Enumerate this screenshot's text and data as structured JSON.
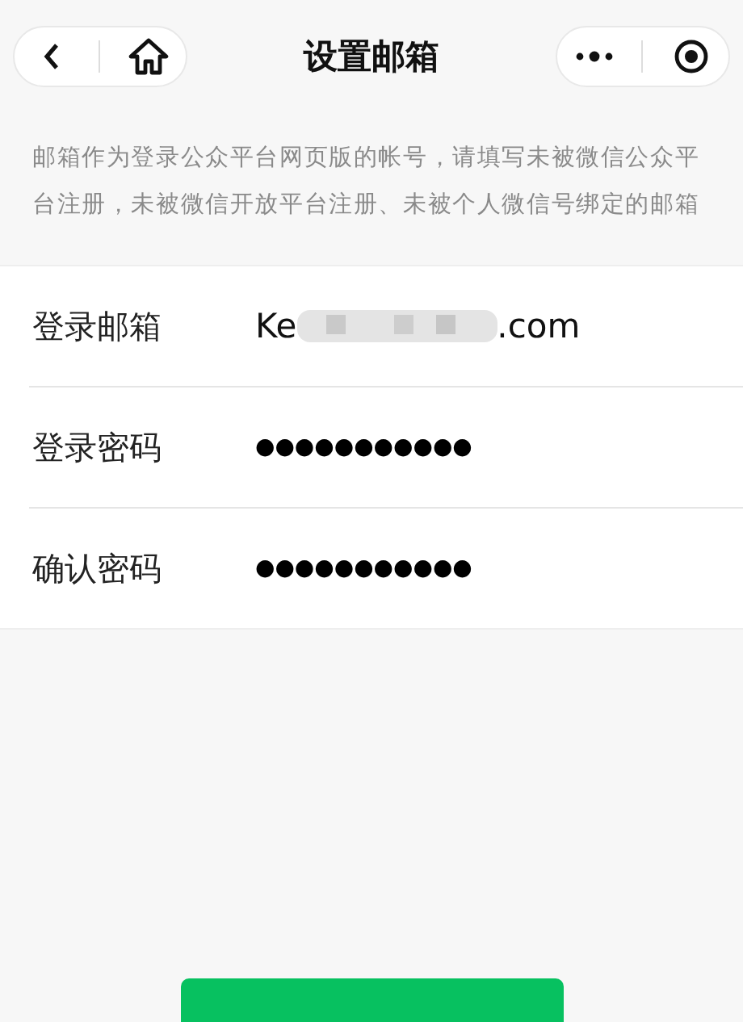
{
  "nav": {
    "title": "设置邮箱"
  },
  "description": "邮箱作为登录公众平台网页版的帐号，请填写未被微信公众平台注册，未被微信开放平台注册、未被个人微信号绑定的邮箱",
  "fields": [
    {
      "label": "登录邮箱",
      "kind": "email",
      "value_start": "Ke",
      "value_end": ".com"
    },
    {
      "label": "登录密码",
      "kind": "password",
      "value": "●●●●●●●●●●●"
    },
    {
      "label": "确认密码",
      "kind": "password",
      "value": "●●●●●●●●●●●"
    }
  ]
}
